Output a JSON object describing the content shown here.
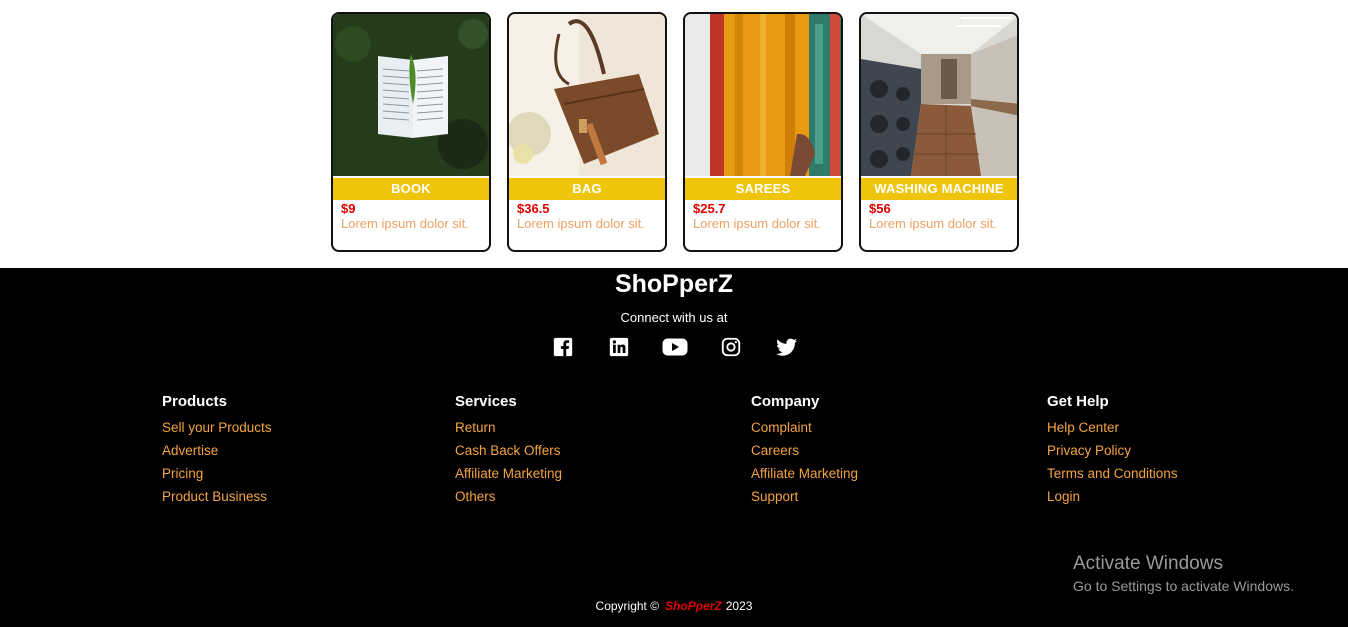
{
  "products": [
    {
      "name": "BOOK",
      "price": "$9",
      "desc": "Lorem ipsum dolor sit."
    },
    {
      "name": "BAG",
      "price": "$36.5",
      "desc": "Lorem ipsum dolor sit."
    },
    {
      "name": "SAREES",
      "price": "$25.7",
      "desc": "Lorem ipsum dolor sit."
    },
    {
      "name": "WASHING MACHINE",
      "price": "$56",
      "desc": "Lorem ipsum dolor sit."
    }
  ],
  "footer": {
    "brand": "ShoPperZ",
    "connect": "Connect with us at",
    "socials": [
      "facebook-icon",
      "linkedin-icon",
      "youtube-icon",
      "instagram-icon",
      "twitter-icon"
    ],
    "columns": [
      {
        "heading": "Products",
        "links": [
          "Sell your Products",
          "Advertise",
          "Pricing",
          "Product Business"
        ]
      },
      {
        "heading": "Services",
        "links": [
          "Return",
          "Cash Back Offers",
          "Affiliate Marketing",
          "Others"
        ]
      },
      {
        "heading": "Company",
        "links": [
          "Complaint",
          "Careers",
          "Affiliate Marketing",
          "Support"
        ]
      },
      {
        "heading": "Get Help",
        "links": [
          "Help Center",
          "Privacy Policy",
          "Terms and Conditions",
          "Login"
        ]
      }
    ],
    "copyright": {
      "prefix": "Copyright ©",
      "brand": "ShoPperZ",
      "year": "2023"
    }
  },
  "activate_windows": {
    "title": "Activate Windows",
    "subtitle": "Go to Settings to activate Windows."
  },
  "colors": {
    "accent_yellow": "#efc40c",
    "price_red": "#e00000",
    "link_orange": "#f3a342",
    "footer_bg": "#000000"
  }
}
